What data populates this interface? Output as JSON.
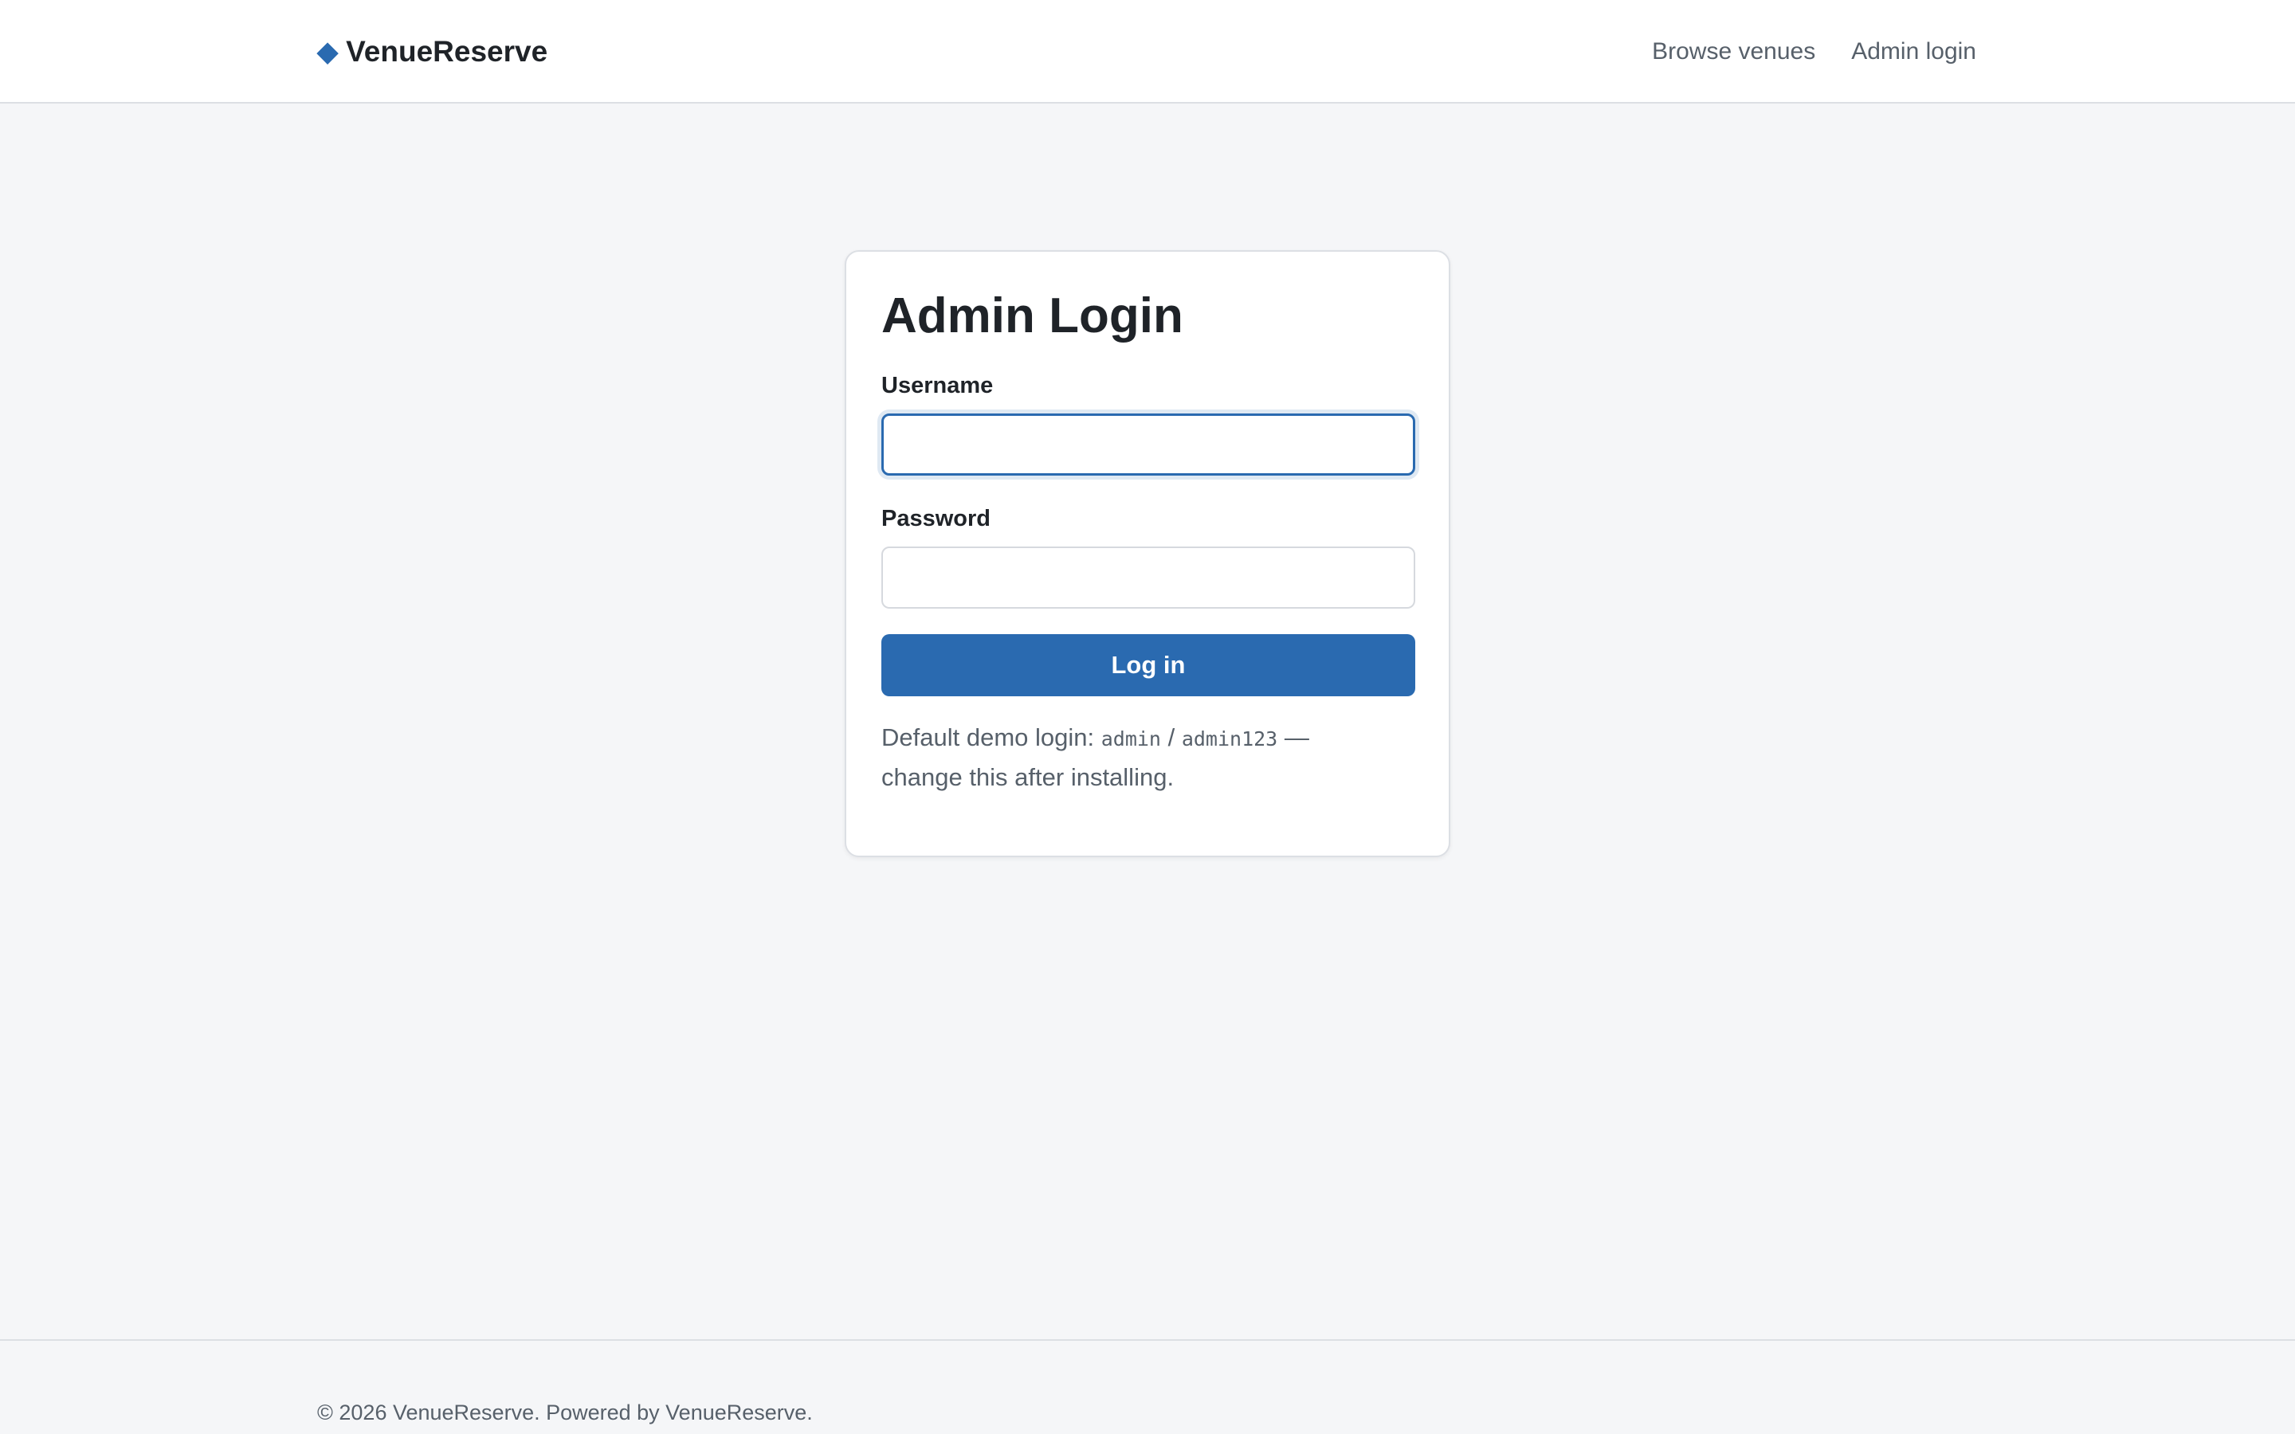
{
  "header": {
    "brand_icon": "◆",
    "brand_name": "VenueReserve",
    "nav": [
      {
        "label": "Browse venues"
      },
      {
        "label": "Admin login"
      }
    ]
  },
  "login": {
    "title": "Admin Login",
    "username_label": "Username",
    "username_value": "",
    "username_placeholder": "",
    "password_label": "Password",
    "password_value": "",
    "password_placeholder": "",
    "submit_label": "Log in",
    "hint_prefix": "Default demo login: ",
    "hint_user": "admin",
    "hint_sep": " / ",
    "hint_pass": "admin123",
    "hint_suffix": " — change this after installing."
  },
  "footer": {
    "text": "© 2026 VenueReserve. Powered by VenueReserve."
  },
  "colors": {
    "accent": "#2a6ab0",
    "background": "#f5f6f8",
    "muted_text": "#57606a"
  },
  "icons": {
    "brand": "diamond-icon"
  }
}
